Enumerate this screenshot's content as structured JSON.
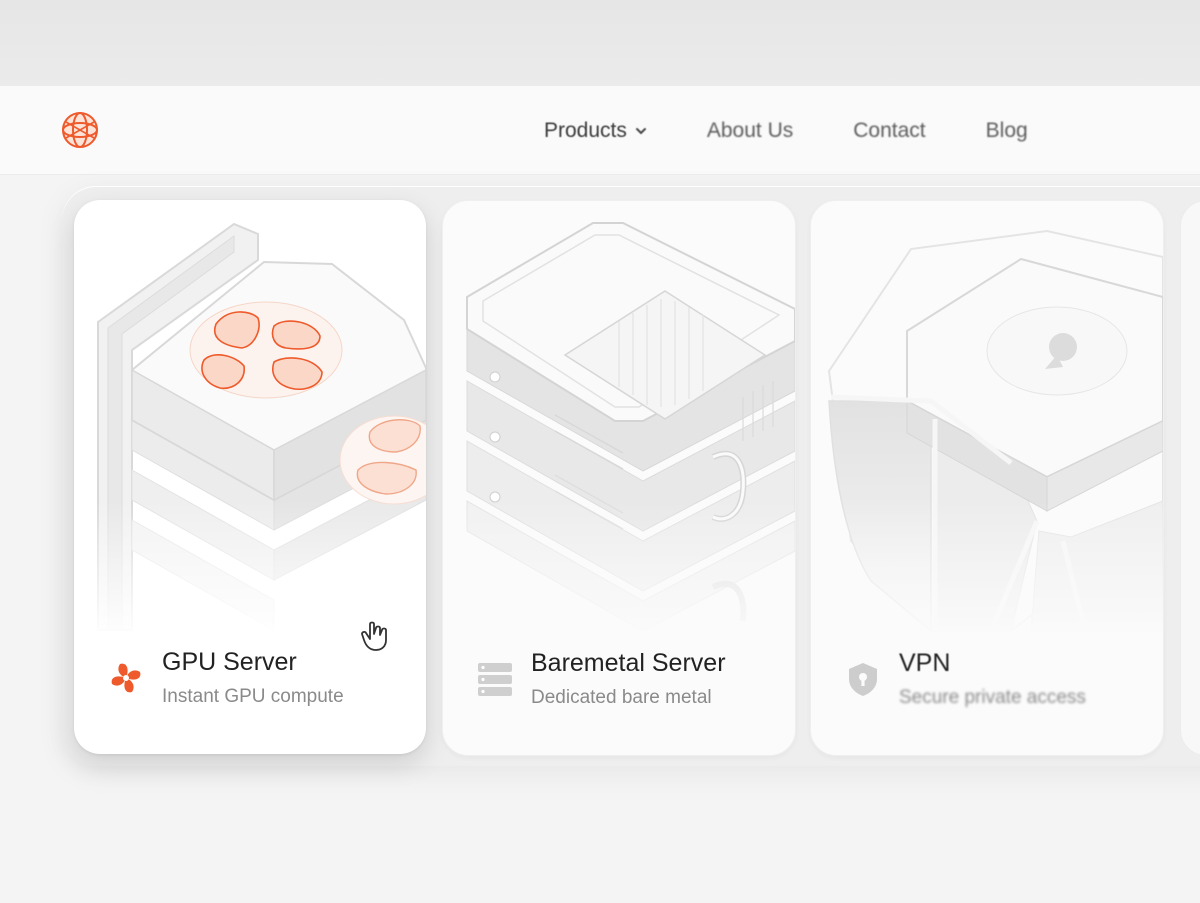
{
  "nav": {
    "items": [
      {
        "label": "Products",
        "active": true
      },
      {
        "label": "About Us"
      },
      {
        "label": "Contact"
      },
      {
        "label": "Blog"
      }
    ]
  },
  "cards": [
    {
      "title": "GPU Server",
      "subtitle": "Instant GPU compute",
      "icon": "fan-icon",
      "active": true
    },
    {
      "title": "Baremetal Server",
      "subtitle": "Dedicated bare metal",
      "icon": "server-stack-icon"
    },
    {
      "title": "VPN",
      "subtitle": "Secure private access",
      "icon": "shield-icon"
    }
  ],
  "colors": {
    "accent": "#ee5a2b",
    "accent_light": "#fbd7c7",
    "text_primary": "#222222",
    "text_secondary": "#8a8a8a"
  }
}
